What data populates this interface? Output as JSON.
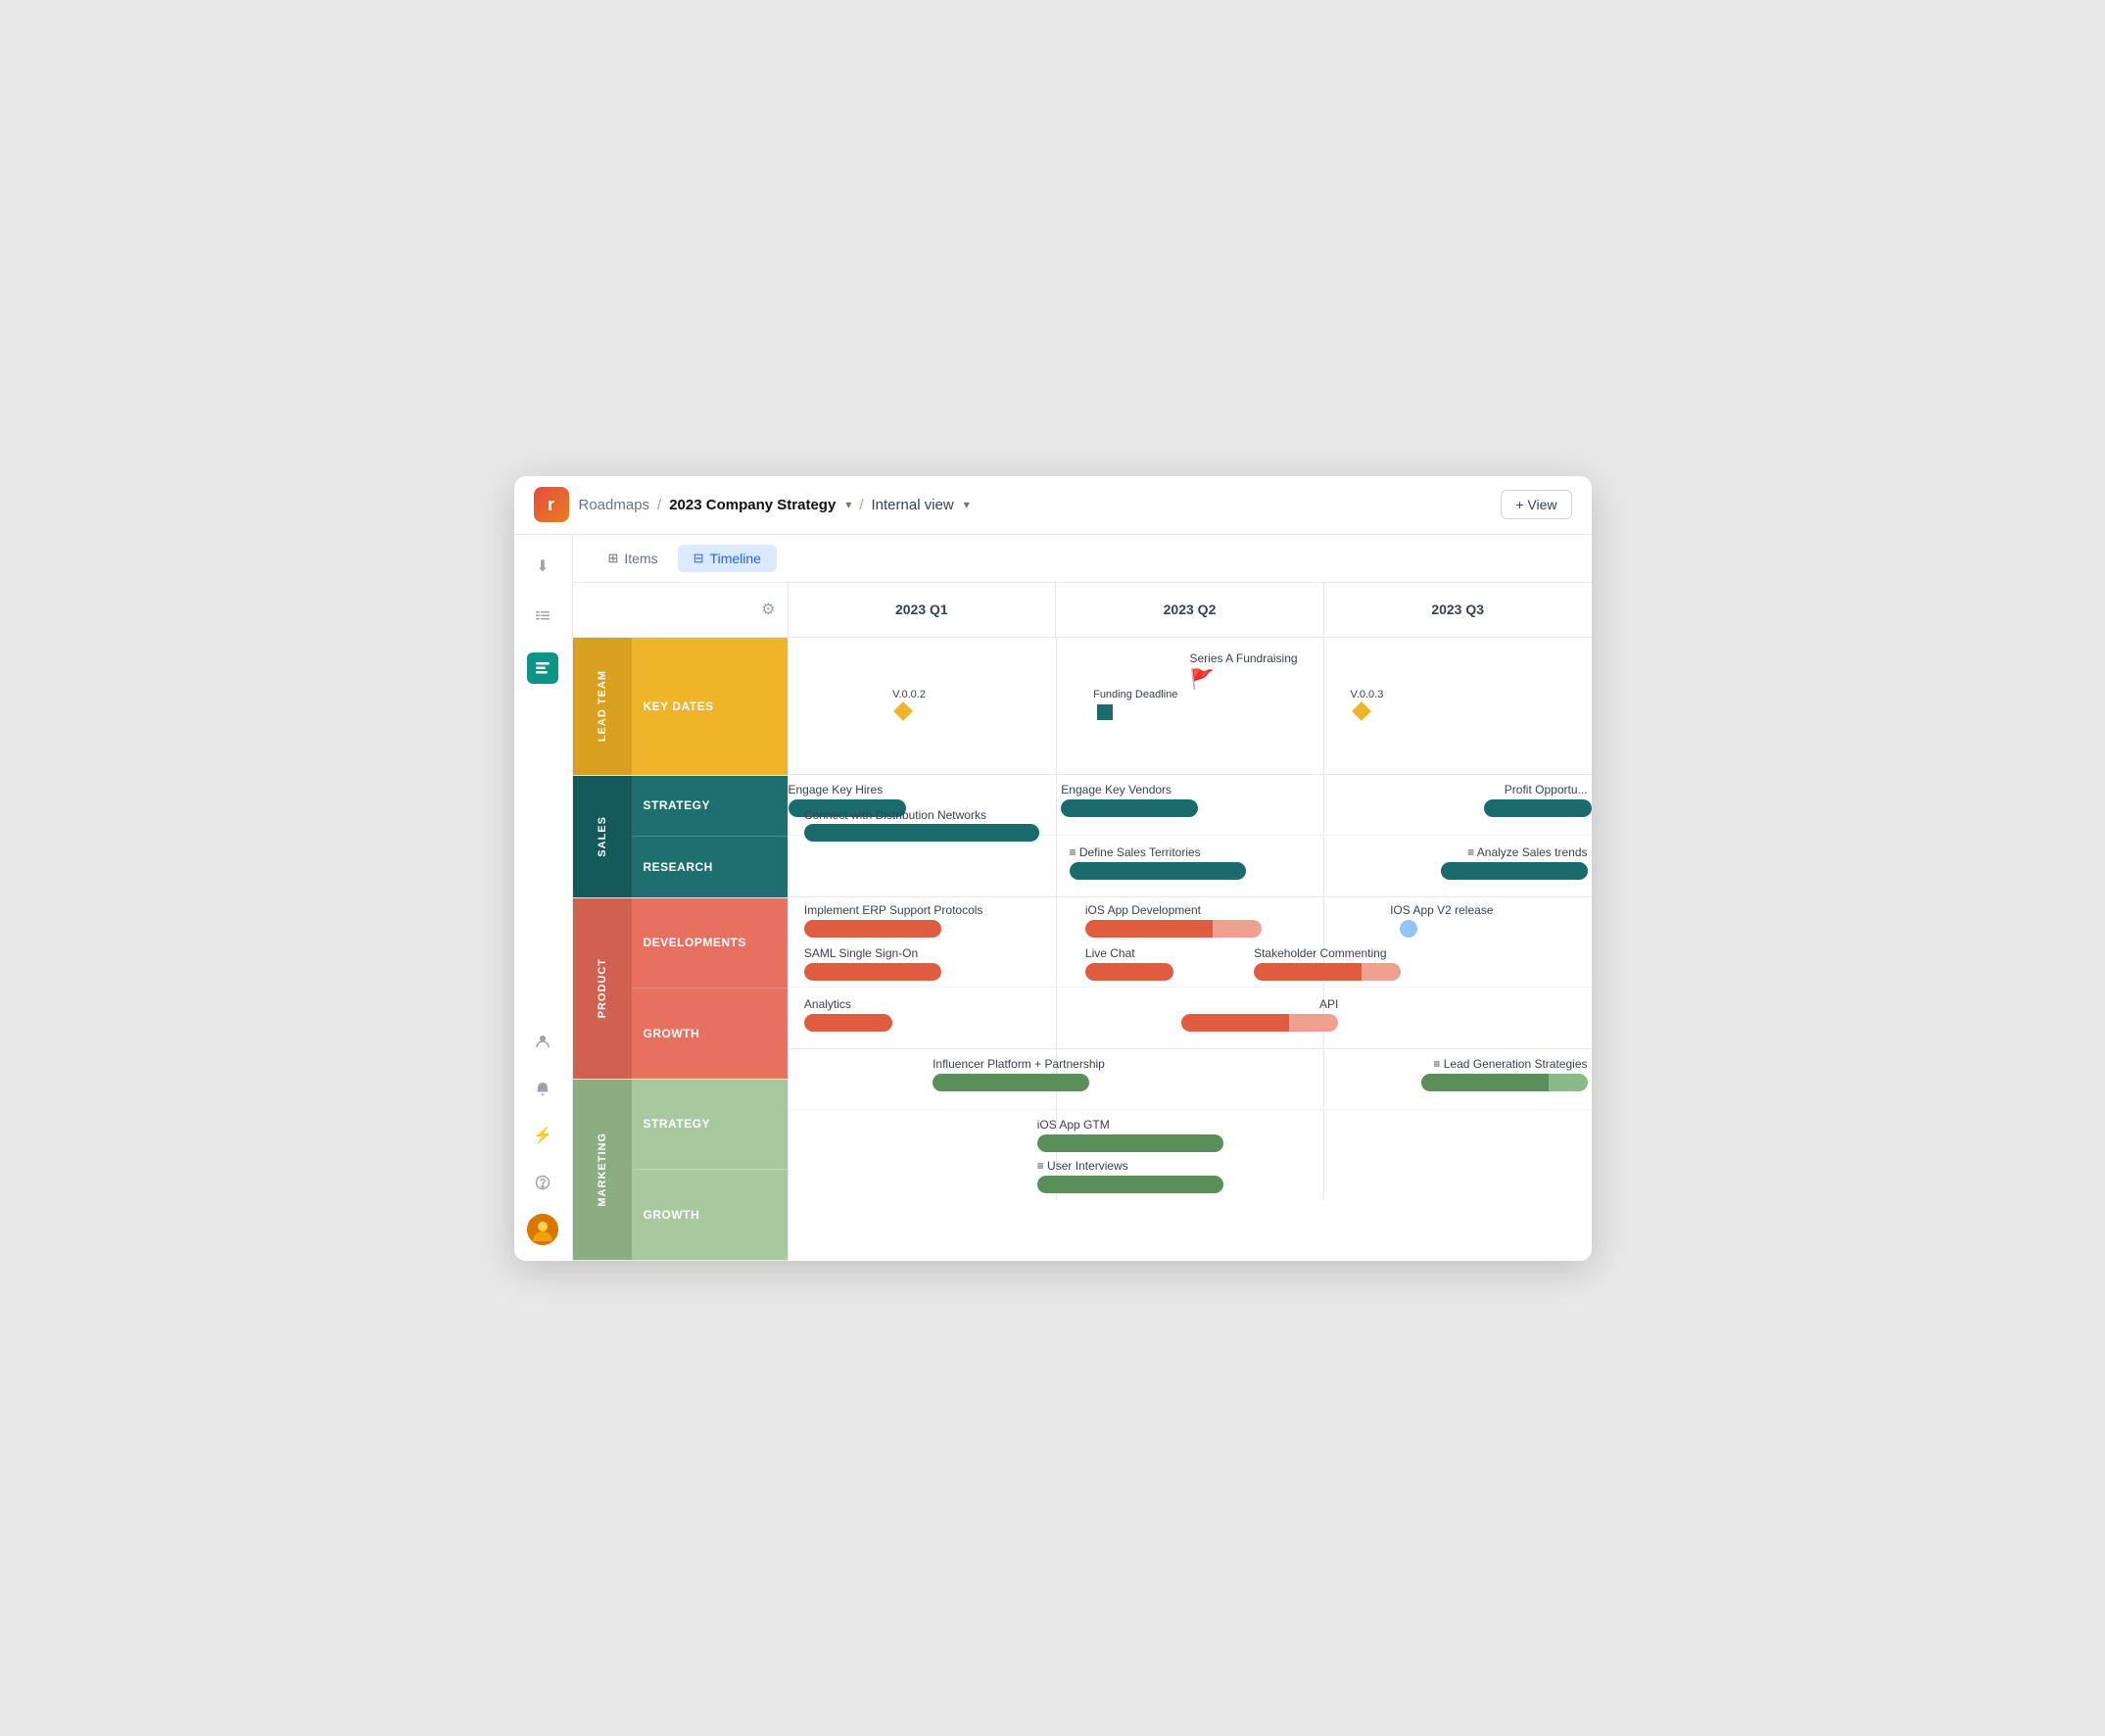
{
  "header": {
    "logo_text": "r",
    "breadcrumb": [
      {
        "label": "Roadmaps",
        "active": false
      },
      {
        "label": "2023 Company Strategy",
        "active": true
      },
      {
        "label": "Internal view",
        "active": false
      }
    ],
    "view_button": "+ View"
  },
  "tabs": [
    {
      "label": "Items",
      "icon": "≡",
      "active": false
    },
    {
      "label": "Timeline",
      "icon": "⊞",
      "active": true
    }
  ],
  "quarters": [
    "2023 Q1",
    "2023 Q2",
    "2023 Q3"
  ],
  "groups": [
    {
      "id": "lead",
      "label": "LEAD TEAM",
      "color": "#f0b429",
      "subgroups": [
        {
          "id": "key-dates",
          "label": "KEY DATES"
        }
      ]
    },
    {
      "id": "sales",
      "label": "SALES",
      "color": "#1a6b6b",
      "subgroups": [
        {
          "id": "strategy",
          "label": "STRATEGY"
        },
        {
          "id": "research",
          "label": "RESEARCH"
        }
      ]
    },
    {
      "id": "product",
      "label": "PRODUCT",
      "color": "#e07060",
      "subgroups": [
        {
          "id": "developments",
          "label": "DEVELOPMENTS"
        },
        {
          "id": "growth",
          "label": "GROWTH"
        }
      ]
    },
    {
      "id": "marketing",
      "label": "MARKETING",
      "color": "#8aba8a",
      "subgroups": [
        {
          "id": "strategy",
          "label": "STRATEGY"
        },
        {
          "id": "growth",
          "label": "GROWTH"
        }
      ]
    }
  ],
  "timeline_items": {
    "key_dates": {
      "flag": {
        "label": "Series A Fundraising",
        "q_pct": 55
      },
      "milestones": [
        {
          "label": "V.0.0.2",
          "q_pct": 15,
          "q": 1
        },
        {
          "label": "Funding Deadline",
          "q_pct": 40,
          "q": 1,
          "type": "square"
        },
        {
          "label": "V.0.0.3",
          "q_pct": 72,
          "q": 1
        }
      ]
    },
    "sales_strategy": [
      {
        "label": "Engage Key Hires",
        "start": 0,
        "width": 15,
        "color": "teal"
      },
      {
        "label": "Engage Key Vendors",
        "start": 32,
        "width": 18,
        "color": "teal"
      },
      {
        "label": "Connect with Distribution Networks",
        "start": 5,
        "width": 30,
        "color": "teal"
      },
      {
        "label": "Profit Opportu...",
        "start": 85,
        "width": 14,
        "color": "teal"
      }
    ],
    "sales_research": [
      {
        "label": "Define Sales Territories",
        "start": 38,
        "width": 22,
        "color": "teal",
        "icon": true
      },
      {
        "label": "Analyze Sales trends",
        "start": 75,
        "width": 18,
        "color": "teal",
        "icon": true
      }
    ],
    "product_dev": [
      {
        "label": "Implement ERP Support Protocols",
        "start": 5,
        "width": 18,
        "color": "red"
      },
      {
        "label": "iOS App Development",
        "start": 37,
        "width": 18,
        "color": "red"
      },
      {
        "label": "iOS App V2 release",
        "start": 73,
        "width": 0,
        "color": "none",
        "dot": true
      },
      {
        "label": "SAML Single Sign-On",
        "start": 5,
        "width": 18,
        "color": "red"
      },
      {
        "label": "Live Chat",
        "start": 37,
        "width": 12,
        "color": "red"
      },
      {
        "label": "Stakeholder Commenting",
        "start": 58,
        "width": 16,
        "color": "red"
      }
    ],
    "product_growth": [
      {
        "label": "Analytics",
        "start": 5,
        "width": 12,
        "color": "red"
      },
      {
        "label": "API",
        "start": 50,
        "width": 18,
        "color": "red"
      }
    ],
    "marketing_strategy": [
      {
        "label": "Influencer Platform + Partnership",
        "start": 20,
        "width": 22,
        "color": "green"
      },
      {
        "label": "Lead Generation Strategies",
        "start": 68,
        "width": 20,
        "color": "green",
        "icon": true
      }
    ],
    "marketing_growth": [
      {
        "label": "iOS App GTM",
        "start": 32,
        "width": 26,
        "color": "green"
      },
      {
        "label": "User Interviews",
        "start": 32,
        "width": 26,
        "color": "green",
        "icon": true
      }
    ]
  },
  "sidebar_icons": [
    {
      "name": "download",
      "icon": "⬇",
      "active": false
    },
    {
      "name": "list",
      "icon": "≡",
      "active": false
    },
    {
      "name": "roadmap",
      "icon": "≡",
      "active": true
    },
    {
      "name": "contacts",
      "icon": "👤",
      "active": false
    },
    {
      "name": "bell",
      "icon": "🔔",
      "active": false
    },
    {
      "name": "bolt",
      "icon": "⚡",
      "active": false
    },
    {
      "name": "help",
      "icon": "?",
      "active": false
    }
  ]
}
